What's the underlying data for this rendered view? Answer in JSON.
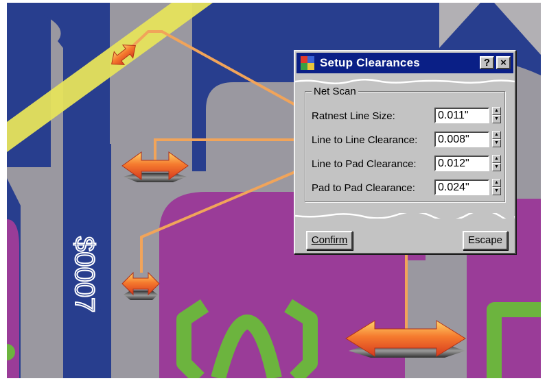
{
  "dialog": {
    "title": "Setup Clearances",
    "help_label": "?",
    "close_label": "×",
    "group_label": "Net Scan",
    "rows": [
      {
        "label": "Ratnest Line Size:",
        "value": "0.011\""
      },
      {
        "label": "Line to Line Clearance:",
        "value": "0.008\""
      },
      {
        "label": "Line to Pad Clearance:",
        "value": "0.012\""
      },
      {
        "label": "Pad to Pad Clearance:",
        "value": "0.024\""
      }
    ],
    "confirm_label": "Confirm",
    "escape_label": "Escape"
  },
  "board": {
    "silkscreen_text": "$0007"
  },
  "colors": {
    "board_gray": "#9a98a0",
    "trace_blue": "#283e8e",
    "pad_magenta": "#9a3c98",
    "silk_green": "#6cb43e",
    "ratsnest_yellow": "#e6e35c",
    "callout_orange": "#f1a45a",
    "titlebar": "#0a1f86",
    "dialog_face": "#c3c3c3"
  }
}
